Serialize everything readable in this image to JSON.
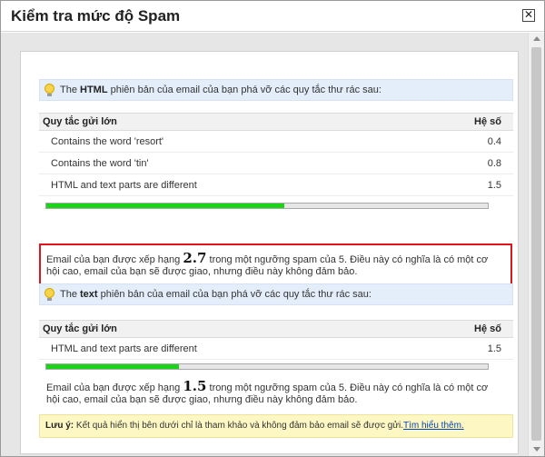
{
  "dialog": {
    "title": "Kiểm tra mức độ Spam"
  },
  "html_section": {
    "heading_prefix": "The ",
    "heading_bold": "HTML",
    "heading_suffix": " phiên bản của email của bạn phá vỡ các quy tắc thư rác sau:",
    "col_rule": "Quy tắc gửi lớn",
    "col_coef": "Hệ số",
    "rows": [
      {
        "rule": "Contains the word 'resort'",
        "coef": "0.4"
      },
      {
        "rule": "Contains the word 'tin'",
        "coef": "0.8"
      },
      {
        "rule": "HTML and text parts are different",
        "coef": "1.5"
      }
    ],
    "bar_fraction": 0.54,
    "score_before": "Email của bạn được xếp hạng ",
    "score": "2.7",
    "score_after": " trong một ngưỡng spam của 5. Điều này có nghĩa là có một cơ hội cao, email của bạn sẽ được giao, nhưng điều này không đảm bảo."
  },
  "text_section": {
    "heading_prefix": "The ",
    "heading_bold": "text",
    "heading_suffix": " phiên bản của email của bạn phá vỡ các quy tắc thư rác sau:",
    "col_rule": "Quy tắc gửi lớn",
    "col_coef": "Hệ số",
    "rows": [
      {
        "rule": "HTML and text parts are different",
        "coef": "1.5"
      }
    ],
    "bar_fraction": 0.3,
    "score_before": "Email của bạn được xếp hạng ",
    "score": "1.5",
    "score_after": " trong một ngưỡng spam của 5. Điều này có nghĩa là có một cơ hội cao, email của bạn sẽ được giao, nhưng điều này không đảm bảo."
  },
  "note": {
    "label": "Lưu ý:",
    "text": " Kết quả hiển thị bên dưới chỉ là tham khảo và không đảm bảo email sẽ được gửi.",
    "link": "Tìm hiểu thêm."
  },
  "colors": {
    "accent_bar": "#19d417",
    "highlight_border": "#e0141c",
    "section_bg": "#e4eefb",
    "note_bg": "#fdf7c4"
  }
}
